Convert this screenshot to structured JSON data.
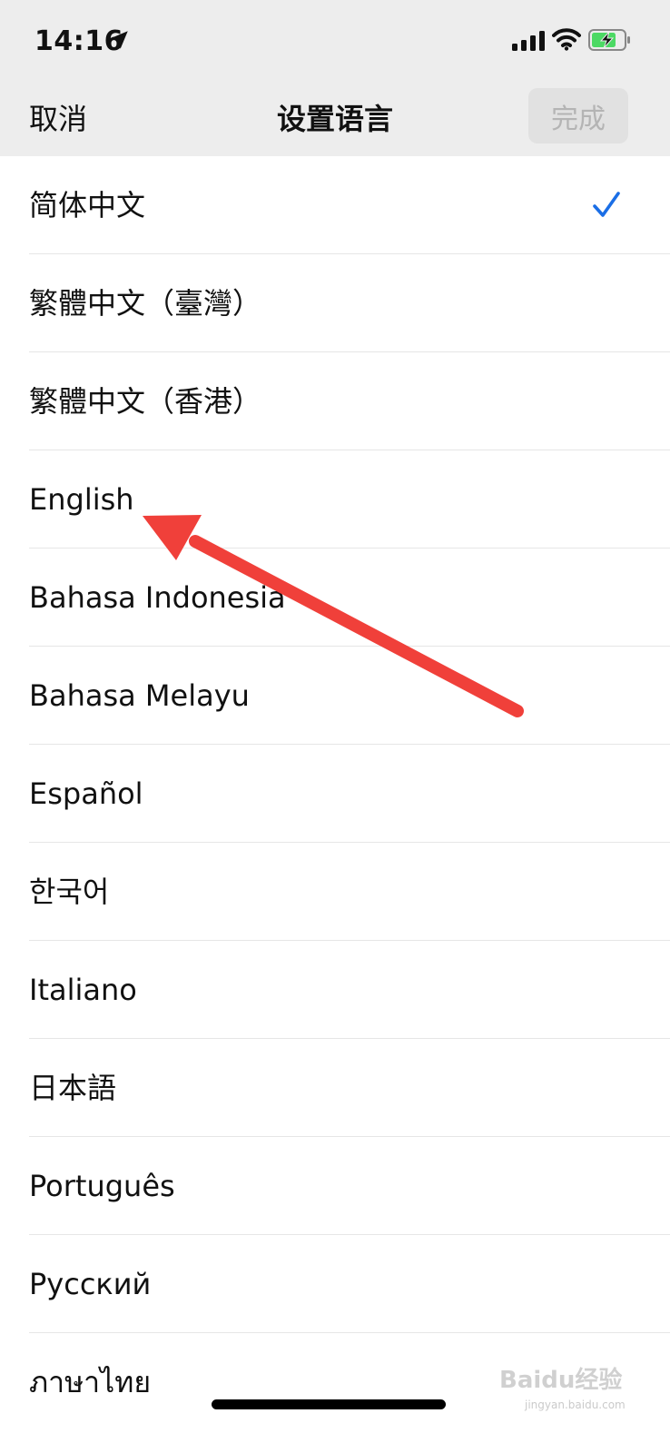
{
  "status_bar": {
    "time": "14:16",
    "icons": [
      "location-arrow-icon",
      "cellular-signal-icon",
      "wifi-icon",
      "battery-charging-icon"
    ]
  },
  "nav": {
    "cancel_label": "取消",
    "title": "设置语言",
    "done_label": "完成"
  },
  "languages": [
    {
      "label": "简体中文",
      "selected": true
    },
    {
      "label": "繁體中文（臺灣）",
      "selected": false
    },
    {
      "label": "繁體中文（香港）",
      "selected": false
    },
    {
      "label": "English",
      "selected": false
    },
    {
      "label": "Bahasa Indonesia",
      "selected": false
    },
    {
      "label": "Bahasa Melayu",
      "selected": false
    },
    {
      "label": "Español",
      "selected": false
    },
    {
      "label": "한국어",
      "selected": false
    },
    {
      "label": "Italiano",
      "selected": false
    },
    {
      "label": "日本語",
      "selected": false
    },
    {
      "label": "Português",
      "selected": false
    },
    {
      "label": "Русский",
      "selected": false
    },
    {
      "label": "ภาษาไทย",
      "selected": false
    }
  ],
  "watermark": {
    "text": "Baidu经验",
    "sub": "jingyan.baidu.com"
  },
  "colors": {
    "header_bg": "#ededed",
    "check": "#1a6ee6",
    "annotation_arrow": "#f0403a",
    "done_bg": "#e1e1e1",
    "done_text": "#b4b4b4"
  }
}
